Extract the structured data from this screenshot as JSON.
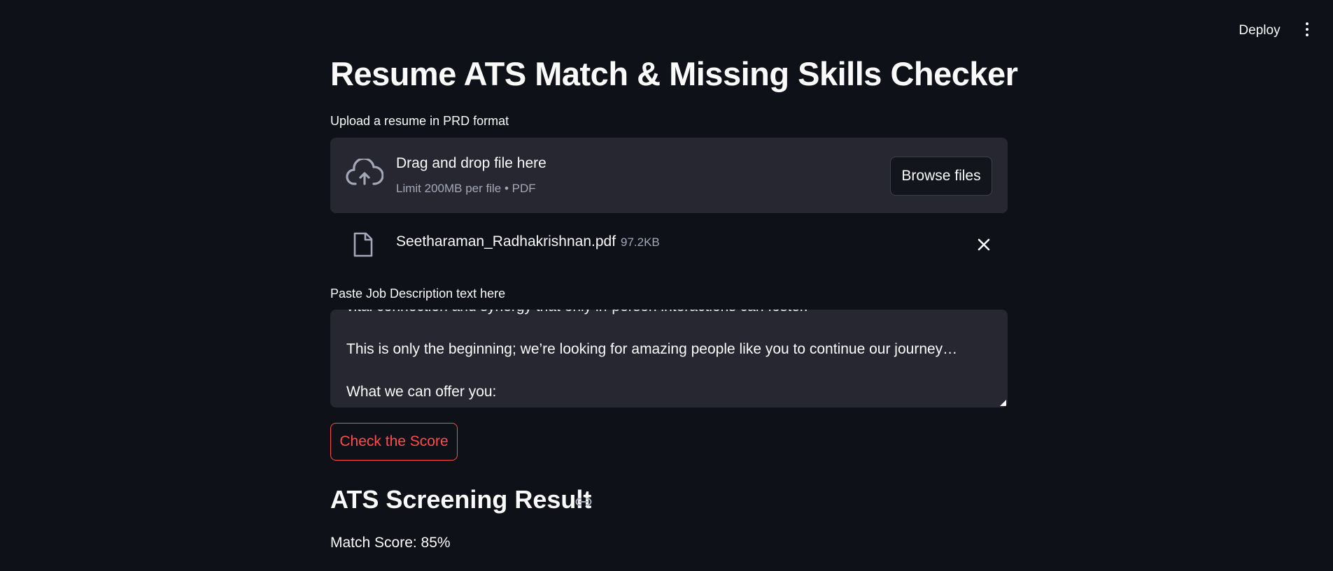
{
  "header": {
    "deploy_label": "Deploy",
    "menu_icon": "kebab-menu-icon"
  },
  "main": {
    "title": "Resume ATS Match & Missing Skills Checker",
    "upload": {
      "label": "Upload a resume in PRD format",
      "drop_text": "Drag and drop file here",
      "limit_text": "Limit 200MB per file • PDF",
      "browse_label": "Browse files",
      "icon": "cloud-upload-icon"
    },
    "uploaded_file": {
      "name": "Seetharaman_Radhakrishnan.pdf",
      "size": "97.2KB",
      "icon": "file-icon",
      "remove_icon": "close-icon"
    },
    "job_description": {
      "label": "Paste Job Description text here",
      "value": "vital connection and synergy that only in-person interactions can foster.\n\nThis is only the beginning; we’re looking for amazing people like you to continue our journey…\n\nWhat we can offer you:"
    },
    "check_button_label": "Check the Score",
    "result": {
      "heading": "ATS Screening Result",
      "anchor_icon": "link-icon",
      "match_score_text": "Match Score: 85%"
    }
  },
  "colors": {
    "background": "#0e1117",
    "surface": "#262730",
    "primary": "#ff4b4b",
    "text": "#fafafa",
    "muted_text": "#a3a8b8"
  }
}
